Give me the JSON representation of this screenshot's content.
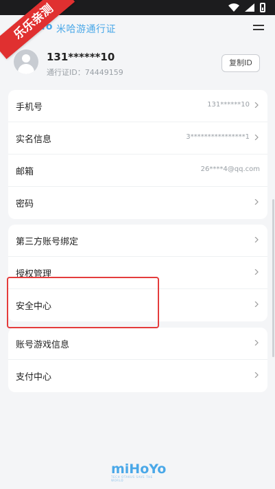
{
  "watermark": "乐乐亲测",
  "header": {
    "logo_fragment": "Yo",
    "title": "米哈游通行证"
  },
  "profile": {
    "username": "131******10",
    "pass_id": "通行证ID：74449159",
    "copy_button": "复制ID"
  },
  "account_info": [
    {
      "label": "手机号",
      "value": "131******10",
      "arrow": true
    },
    {
      "label": "实名信息",
      "value": "3****************1",
      "arrow": true
    },
    {
      "label": "邮箱",
      "value": "26****4@qq.com",
      "arrow": false
    },
    {
      "label": "密码",
      "value": "",
      "arrow": true
    }
  ],
  "security_settings": [
    {
      "label": "第三方账号绑定",
      "arrow": true
    },
    {
      "label": "授权管理",
      "arrow": true
    },
    {
      "label": "安全中心",
      "arrow": true
    }
  ],
  "game_settings": [
    {
      "label": "账号游戏信息",
      "arrow": true
    },
    {
      "label": "支付中心",
      "arrow": true
    }
  ],
  "footer": {
    "brand": "miHoYo",
    "tagline": "TECH OTAKUS SAVE THE WORLD"
  },
  "colors": {
    "accent": "#4aa8e8",
    "highlight": "#e43b3b",
    "watermark": "#e03030"
  }
}
